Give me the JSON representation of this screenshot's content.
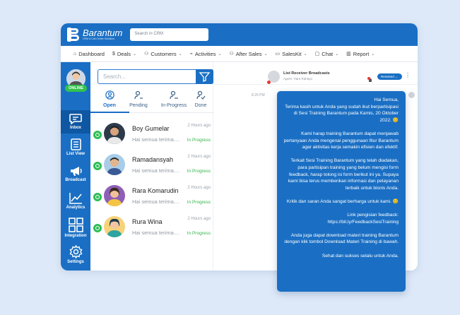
{
  "brand": {
    "name": "Barantum",
    "tagline": "CRM & Call Center Solutions"
  },
  "topbar": {
    "search_placeholder": "Search in CRM"
  },
  "menu": [
    {
      "label": "Dashboard",
      "icon": "home-icon",
      "chev": ""
    },
    {
      "label": "Deals",
      "icon": "dollar-icon",
      "chev": "⌄"
    },
    {
      "label": "Customers",
      "icon": "users-icon",
      "chev": "⌄"
    },
    {
      "label": "Activities",
      "icon": "activity-icon",
      "chev": "⌄"
    },
    {
      "label": "After Sales",
      "icon": "users-icon",
      "chev": "⌄"
    },
    {
      "label": "SalesKit",
      "icon": "folder-icon",
      "chev": "⌄"
    },
    {
      "label": "Chat",
      "icon": "chat-icon",
      "chev": "⌄"
    },
    {
      "label": "Report",
      "icon": "report-icon",
      "chev": "⌄"
    }
  ],
  "sidebar": {
    "status": "ONLINE",
    "items": [
      {
        "label": "Inbox",
        "icon": "chat-icon",
        "active": true
      },
      {
        "label": "List View",
        "icon": "list-icon",
        "active": false
      },
      {
        "label": "Broadcast",
        "icon": "megaphone-icon",
        "active": false
      },
      {
        "label": "Analytics",
        "icon": "chart-icon",
        "active": false
      },
      {
        "label": "Integration",
        "icon": "grid-icon",
        "active": false
      },
      {
        "label": "Settings",
        "icon": "gear-icon",
        "active": false
      }
    ]
  },
  "conversations": {
    "search_placeholder": "Search...",
    "tabs": [
      {
        "label": "Open",
        "active": true
      },
      {
        "label": "Pending",
        "active": false
      },
      {
        "label": "In-Progress",
        "active": false
      },
      {
        "label": "Done",
        "active": false
      }
    ],
    "items": [
      {
        "name": "Boy Gumelar",
        "preview": "Hai semua terima....",
        "time": "2 Hours ago",
        "status": "In Progress"
      },
      {
        "name": "Ramadansyah",
        "preview": "Hai semua terima....",
        "time": "2 Hours ago",
        "status": "In Progress"
      },
      {
        "name": "Rara Komarudin",
        "preview": "Hai semua terima....",
        "time": "2 Hours ago",
        "status": "In Progress"
      },
      {
        "name": "Rura Wina",
        "preview": "Hai semua terima....",
        "time": "2 Hours ago",
        "status": "In Progress"
      }
    ]
  },
  "detail": {
    "title": "List Receiver Broadcasts",
    "subtitle": "Agent: Tiara Rahayu",
    "status": "Resolved",
    "message_time": "8.20 PM",
    "message_paragraphs": [
      "Hai Semua,\nTerima kasih untuk Anda yang sudah ikut berpartisipasi di Sesi Training Barantum pada Kamis, 20 Oktober 2022. 😊",
      "Kami harap training Barantum dapat menjawab pertanyaan Anda mengenai penggunaan fitur Barantum agar aktivitas kerja semakin efisien dan efektif.",
      "Terkait Sesi Training Barantum yang telah diadakan, para partisipan training yang belum mengisi form feedback, harap tolong isi form berikut ini ya. Supaya kami bisa terus memberikan informasi dan pelayanan terbaik untuk bisnis Anda.",
      "Kritik dan saran Anda sangat berharga untuk kami. 😊",
      "Link pengisian feedback:\nhttps://bit.ly/FeedbackSesiTraining",
      "Anda juga dapat download materi training Barantum dengan klik tombol Download Materi Training di bawah.",
      "Sehat dan sukses selalu untuk Anda."
    ]
  },
  "colors": {
    "primary": "#1a6fc4",
    "online": "#33c24d",
    "in_progress": "#35b44b",
    "whatsapp": "#2ebd55"
  }
}
